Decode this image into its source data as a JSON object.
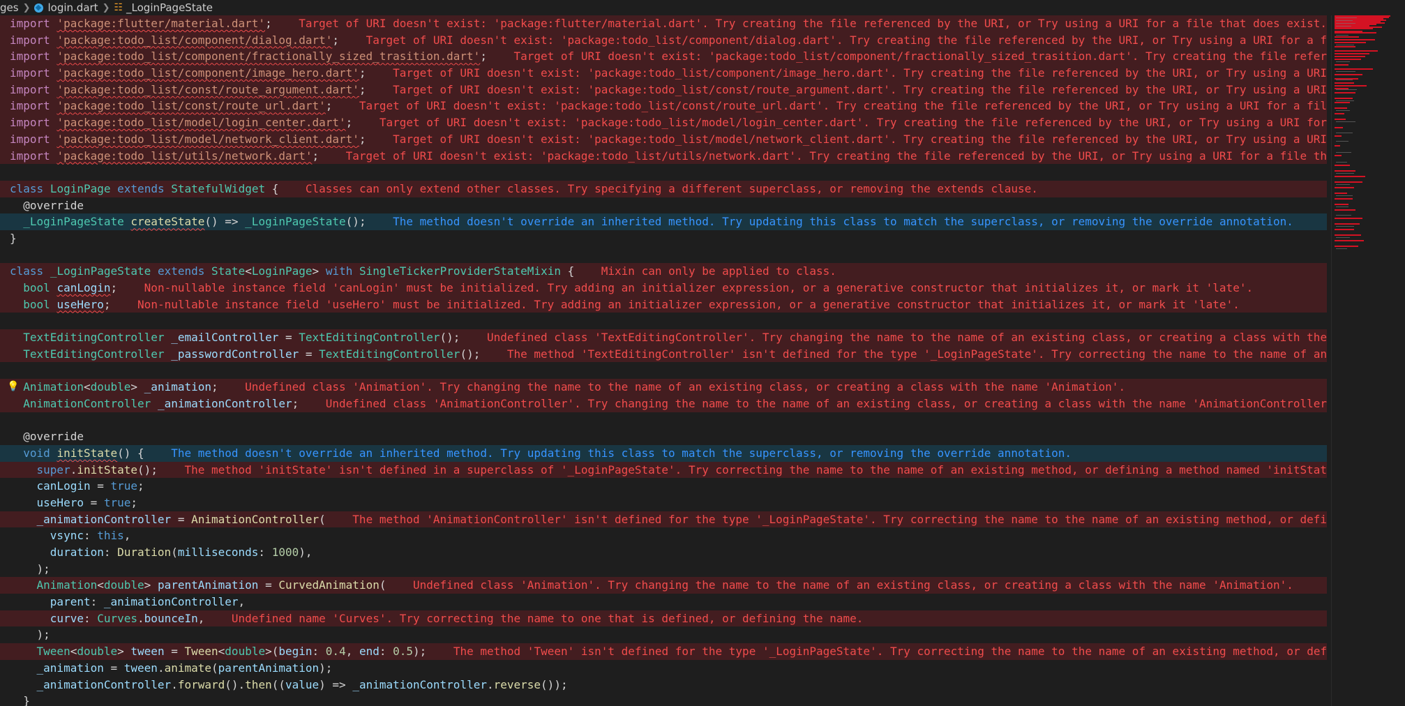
{
  "breadcrumb": {
    "folder": "ges",
    "file": "login.dart",
    "symbol": "_LoginPageState"
  },
  "lines": [
    {
      "kind": "err",
      "parts": [
        [
          "kw2",
          "import"
        ],
        [
          "",
          "&nbsp;"
        ],
        [
          "str sq",
          "'package:flutter/material.dart'"
        ],
        [
          "",
          ";"
        ]
      ],
      "msg": "Target of URI doesn't exist: 'package:flutter/material.dart'. Try creating the file referenced by the URI, or Try using a URI for a file that does exist."
    },
    {
      "kind": "err",
      "parts": [
        [
          "kw2",
          "import"
        ],
        [
          "",
          "&nbsp;"
        ],
        [
          "str sq",
          "'package:todo_list/component/dialog.dart'"
        ],
        [
          "",
          ";"
        ]
      ],
      "msg": "Target of URI doesn't exist: 'package:todo_list/component/dialog.dart'. Try creating the file referenced by the URI, or Try using a URI for a file that does exist."
    },
    {
      "kind": "err",
      "parts": [
        [
          "kw2",
          "import"
        ],
        [
          "",
          "&nbsp;"
        ],
        [
          "str sq",
          "'package:todo_list/component/fractionally_sized_trasition.dart'"
        ],
        [
          "",
          ";"
        ]
      ],
      "msg": "Target of URI doesn't exist: 'package:todo_list/component/fractionally_sized_trasition.dart'. Try creating the file referenced by the URI, or Try using a URI for a file that does exist."
    },
    {
      "kind": "err",
      "parts": [
        [
          "kw2",
          "import"
        ],
        [
          "",
          "&nbsp;"
        ],
        [
          "str sq",
          "'package:todo_list/component/image_hero.dart'"
        ],
        [
          "",
          ";"
        ]
      ],
      "msg": "Target of URI doesn't exist: 'package:todo_list/component/image_hero.dart'. Try creating the file referenced by the URI, or Try using a URI for a file that does exist."
    },
    {
      "kind": "err",
      "parts": [
        [
          "kw2",
          "import"
        ],
        [
          "",
          "&nbsp;"
        ],
        [
          "str sq",
          "'package:todo_list/const/route_argument.dart'"
        ],
        [
          "",
          ";"
        ]
      ],
      "msg": "Target of URI doesn't exist: 'package:todo_list/const/route_argument.dart'. Try creating the file referenced by the URI, or Try using a URI for a file that does exist."
    },
    {
      "kind": "err",
      "parts": [
        [
          "kw2",
          "import"
        ],
        [
          "",
          "&nbsp;"
        ],
        [
          "str sq",
          "'package:todo_list/const/route_url.dart'"
        ],
        [
          "",
          ";"
        ]
      ],
      "msg": "Target of URI doesn't exist: 'package:todo_list/const/route_url.dart'. Try creating the file referenced by the URI, or Try using a URI for a file that does exist."
    },
    {
      "kind": "err",
      "parts": [
        [
          "kw2",
          "import"
        ],
        [
          "",
          "&nbsp;"
        ],
        [
          "str sq",
          "'package:todo_list/model/login_center.dart'"
        ],
        [
          "",
          ";"
        ]
      ],
      "msg": "Target of URI doesn't exist: 'package:todo_list/model/login_center.dart'. Try creating the file referenced by the URI, or Try using a URI for a file that does exist."
    },
    {
      "kind": "err",
      "parts": [
        [
          "kw2",
          "import"
        ],
        [
          "",
          "&nbsp;"
        ],
        [
          "str sq",
          "'package:todo_list/model/network_client.dart'"
        ],
        [
          "",
          ";"
        ]
      ],
      "msg": "Target of URI doesn't exist: 'package:todo_list/model/network_client.dart'. Try creating the file referenced by the URI, or Try using a URI for a file that does exist."
    },
    {
      "kind": "err",
      "parts": [
        [
          "kw2",
          "import"
        ],
        [
          "",
          "&nbsp;"
        ],
        [
          "str sq",
          "'package:todo_list/utils/network.dart'"
        ],
        [
          "",
          ";"
        ]
      ],
      "msg": "Target of URI doesn't exist: 'package:todo_list/utils/network.dart'. Try creating the file referenced by the URI, or Try using a URI for a file that does exist."
    },
    {
      "kind": "",
      "parts": [],
      "msg": ""
    },
    {
      "kind": "err",
      "parts": [
        [
          "kw",
          "class"
        ],
        [
          "",
          "&nbsp;"
        ],
        [
          "ty",
          "LoginPage"
        ],
        [
          "",
          "&nbsp;"
        ],
        [
          "kw",
          "extends"
        ],
        [
          "",
          "&nbsp;"
        ],
        [
          "ty",
          "StatefulWidget"
        ],
        [
          "",
          "&nbsp;{"
        ]
      ],
      "msg": "Classes can only extend other classes. Try specifying a different superclass, or removing the extends clause."
    },
    {
      "kind": "",
      "parts": [
        [
          "",
          "&nbsp;&nbsp;"
        ],
        [
          "ann",
          "@override"
        ]
      ],
      "msg": ""
    },
    {
      "kind": "info",
      "parts": [
        [
          "",
          "&nbsp;&nbsp;"
        ],
        [
          "ty",
          "_LoginPageState"
        ],
        [
          "",
          "&nbsp;"
        ],
        [
          "fn sq",
          "createState"
        ],
        [
          "",
          "() => "
        ],
        [
          "ty",
          "_LoginPageState"
        ],
        [
          "",
          "();"
        ]
      ],
      "msg": "The method doesn't override an inherited method. Try updating this class to match the superclass, or removing the override annotation."
    },
    {
      "kind": "",
      "parts": [
        [
          "",
          "}"
        ]
      ],
      "msg": ""
    },
    {
      "kind": "",
      "parts": [],
      "msg": ""
    },
    {
      "kind": "err",
      "parts": [
        [
          "kw",
          "class"
        ],
        [
          "",
          "&nbsp;"
        ],
        [
          "ty",
          "_LoginPageState"
        ],
        [
          "",
          "&nbsp;"
        ],
        [
          "kw",
          "extends"
        ],
        [
          "",
          "&nbsp;"
        ],
        [
          "ty",
          "State"
        ],
        [
          "",
          "<"
        ],
        [
          "ty",
          "LoginPage"
        ],
        [
          "",
          "> "
        ],
        [
          "kw",
          "with"
        ],
        [
          "",
          "&nbsp;"
        ],
        [
          "ty",
          "SingleTickerProviderStateMixin"
        ],
        [
          "",
          "&nbsp;{"
        ]
      ],
      "msg": "Mixin can only be applied to class."
    },
    {
      "kind": "err",
      "parts": [
        [
          "",
          "&nbsp;&nbsp;"
        ],
        [
          "ty",
          "bool"
        ],
        [
          "",
          "&nbsp;"
        ],
        [
          "var sq",
          "canLogin"
        ],
        [
          "",
          ";"
        ]
      ],
      "msg": "Non-nullable instance field 'canLogin' must be initialized. Try adding an initializer expression, or a generative constructor that initializes it, or mark it 'late'."
    },
    {
      "kind": "err",
      "parts": [
        [
          "",
          "&nbsp;&nbsp;"
        ],
        [
          "ty",
          "bool"
        ],
        [
          "",
          "&nbsp;"
        ],
        [
          "var sq",
          "useHero"
        ],
        [
          "",
          ";"
        ]
      ],
      "msg": "Non-nullable instance field 'useHero' must be initialized. Try adding an initializer expression, or a generative constructor that initializes it, or mark it 'late'."
    },
    {
      "kind": "",
      "parts": [],
      "msg": ""
    },
    {
      "kind": "err",
      "parts": [
        [
          "",
          "&nbsp;&nbsp;"
        ],
        [
          "ty",
          "TextEditingController"
        ],
        [
          "",
          "&nbsp;"
        ],
        [
          "var",
          "_emailController"
        ],
        [
          "",
          " = "
        ],
        [
          "ty",
          "TextEditingController"
        ],
        [
          "",
          "();"
        ]
      ],
      "msg": "Undefined class 'TextEditingController'. Try changing the name to the name of an existing class, or creating a class with the name 'TextEditingController'."
    },
    {
      "kind": "err",
      "parts": [
        [
          "",
          "&nbsp;&nbsp;"
        ],
        [
          "ty",
          "TextEditingController"
        ],
        [
          "",
          "&nbsp;"
        ],
        [
          "var",
          "_passwordController"
        ],
        [
          "",
          ""
        ],
        [
          "",
          " = "
        ],
        [
          "ty",
          "TextEditingController"
        ],
        [
          "",
          "();"
        ]
      ],
      "msg": "The method 'TextEditingController' isn't defined for the type '_LoginPageState'. Try correcting the name to the name of an existing method."
    },
    {
      "kind": "",
      "parts": [],
      "msg": ""
    },
    {
      "kind": "err",
      "parts": [
        [
          "",
          "&nbsp;&nbsp;"
        ],
        [
          "ty",
          "Animation"
        ],
        [
          "",
          "<"
        ],
        [
          "ty",
          "double"
        ],
        [
          "",
          "> "
        ],
        [
          "var",
          "_animation"
        ],
        [
          "",
          ";"
        ]
      ],
      "msg": "Undefined class 'Animation'. Try changing the name to the name of an existing class, or creating a class with the name 'Animation'.",
      "bulb": true
    },
    {
      "kind": "err",
      "parts": [
        [
          "",
          "&nbsp;&nbsp;"
        ],
        [
          "ty",
          "AnimationController"
        ],
        [
          "",
          "&nbsp;"
        ],
        [
          "var",
          "_animationController"
        ],
        [
          "",
          ";"
        ]
      ],
      "msg": "Undefined class 'AnimationController'. Try changing the name to the name of an existing class, or creating a class with the name 'AnimationController'."
    },
    {
      "kind": "",
      "parts": [],
      "msg": ""
    },
    {
      "kind": "",
      "parts": [
        [
          "",
          "&nbsp;&nbsp;"
        ],
        [
          "ann",
          "@override"
        ]
      ],
      "msg": ""
    },
    {
      "kind": "info",
      "parts": [
        [
          "",
          "&nbsp;&nbsp;"
        ],
        [
          "kw",
          "void"
        ],
        [
          "",
          "&nbsp;"
        ],
        [
          "fn sq",
          "initState"
        ],
        [
          "",
          "() {"
        ]
      ],
      "msg": "The method doesn't override an inherited method. Try updating this class to match the superclass, or removing the override annotation."
    },
    {
      "kind": "err",
      "parts": [
        [
          "",
          "&nbsp;&nbsp;&nbsp;&nbsp;"
        ],
        [
          "kw",
          "super"
        ],
        [
          "",
          "."
        ],
        [
          "fn",
          "initState"
        ],
        [
          "",
          "();"
        ]
      ],
      "msg": "The method 'initState' isn't defined in a superclass of '_LoginPageState'. Try correcting the name to the name of an existing method, or defining a method named 'initState'."
    },
    {
      "kind": "",
      "parts": [
        [
          "",
          "&nbsp;&nbsp;&nbsp;&nbsp;"
        ],
        [
          "var",
          "canLogin"
        ],
        [
          "",
          " = "
        ],
        [
          "kw",
          "true"
        ],
        [
          "",
          ";"
        ]
      ],
      "msg": ""
    },
    {
      "kind": "",
      "parts": [
        [
          "",
          "&nbsp;&nbsp;&nbsp;&nbsp;"
        ],
        [
          "var",
          "useHero"
        ],
        [
          "",
          " = "
        ],
        [
          "kw",
          "true"
        ],
        [
          "",
          ";"
        ]
      ],
      "msg": ""
    },
    {
      "kind": "err",
      "parts": [
        [
          "",
          "&nbsp;&nbsp;&nbsp;&nbsp;"
        ],
        [
          "var",
          "_animationController"
        ],
        [
          "",
          " = "
        ],
        [
          "fn",
          "AnimationController"
        ],
        [
          "",
          "("
        ]
      ],
      "msg": "The method 'AnimationController' isn't defined for the type '_LoginPageState'. Try correcting the name to the name of an existing method, or defining a method."
    },
    {
      "kind": "",
      "parts": [
        [
          "",
          "&nbsp;&nbsp;&nbsp;&nbsp;&nbsp;&nbsp;"
        ],
        [
          "var",
          "vsync"
        ],
        [
          "",
          ": "
        ],
        [
          "kw",
          "this"
        ],
        [
          "",
          ","
        ]
      ],
      "msg": ""
    },
    {
      "kind": "",
      "parts": [
        [
          "",
          "&nbsp;&nbsp;&nbsp;&nbsp;&nbsp;&nbsp;"
        ],
        [
          "var",
          "duration"
        ],
        [
          "",
          ": "
        ],
        [
          "fn",
          "Duration"
        ],
        [
          "",
          "("
        ],
        [
          "var",
          "milliseconds"
        ],
        [
          "",
          ": "
        ],
        [
          "num",
          "1000"
        ],
        [
          "",
          "),"
        ]
      ],
      "msg": ""
    },
    {
      "kind": "",
      "parts": [
        [
          "",
          "&nbsp;&nbsp;&nbsp;&nbsp;);"
        ]
      ],
      "msg": ""
    },
    {
      "kind": "err",
      "parts": [
        [
          "",
          "&nbsp;&nbsp;&nbsp;&nbsp;"
        ],
        [
          "ty",
          "Animation"
        ],
        [
          "",
          "<"
        ],
        [
          "ty",
          "double"
        ],
        [
          "",
          "> "
        ],
        [
          "var",
          "parentAnimation"
        ],
        [
          "",
          " = "
        ],
        [
          "fn",
          "CurvedAnimation"
        ],
        [
          "",
          "("
        ]
      ],
      "msg": "Undefined class 'Animation'. Try changing the name to the name of an existing class, or creating a class with the name 'Animation'."
    },
    {
      "kind": "",
      "parts": [
        [
          "",
          "&nbsp;&nbsp;&nbsp;&nbsp;&nbsp;&nbsp;"
        ],
        [
          "var",
          "parent"
        ],
        [
          "",
          ": "
        ],
        [
          "var",
          "_animationController"
        ],
        [
          "",
          ","
        ]
      ],
      "msg": ""
    },
    {
      "kind": "err",
      "parts": [
        [
          "",
          "&nbsp;&nbsp;&nbsp;&nbsp;&nbsp;&nbsp;"
        ],
        [
          "var",
          "curve"
        ],
        [
          "",
          ": "
        ],
        [
          "ty",
          "Curves"
        ],
        [
          "",
          "."
        ],
        [
          "var",
          "bounceIn"
        ],
        [
          "",
          ","
        ]
      ],
      "msg": "Undefined name 'Curves'. Try correcting the name to one that is defined, or defining the name."
    },
    {
      "kind": "",
      "parts": [
        [
          "",
          "&nbsp;&nbsp;&nbsp;&nbsp;);"
        ]
      ],
      "msg": ""
    },
    {
      "kind": "err",
      "parts": [
        [
          "",
          "&nbsp;&nbsp;&nbsp;&nbsp;"
        ],
        [
          "ty",
          "Tween"
        ],
        [
          "",
          "<"
        ],
        [
          "ty",
          "double"
        ],
        [
          "",
          "> "
        ],
        [
          "var",
          "tween"
        ],
        [
          "",
          " = "
        ],
        [
          "fn",
          "Tween"
        ],
        [
          "",
          "<"
        ],
        [
          "ty",
          "double"
        ],
        [
          "",
          ">("
        ],
        [
          "var",
          "begin"
        ],
        [
          "",
          ": "
        ],
        [
          "num",
          "0.4"
        ],
        [
          "",
          ", "
        ],
        [
          "var",
          "end"
        ],
        [
          "",
          ": "
        ],
        [
          "num",
          "0.5"
        ],
        [
          "",
          ");"
        ]
      ],
      "msg": "The method 'Tween' isn't defined for the type '_LoginPageState'. Try correcting the name to the name of an existing method, or defining a method named 'Tween'."
    },
    {
      "kind": "",
      "parts": [
        [
          "",
          "&nbsp;&nbsp;&nbsp;&nbsp;"
        ],
        [
          "var",
          "_animation"
        ],
        [
          "",
          " = "
        ],
        [
          "var",
          "tween"
        ],
        [
          "",
          "."
        ],
        [
          "fn",
          "animate"
        ],
        [
          "",
          "("
        ],
        [
          "var",
          "parentAnimation"
        ],
        [
          "",
          ");"
        ]
      ],
      "msg": ""
    },
    {
      "kind": "",
      "parts": [
        [
          "",
          "&nbsp;&nbsp;&nbsp;&nbsp;"
        ],
        [
          "var",
          "_animationController"
        ],
        [
          "",
          "."
        ],
        [
          "fn",
          "forward"
        ],
        [
          "",
          "()."
        ],
        [
          "fn",
          "then"
        ],
        [
          "",
          "(("
        ],
        [
          "var",
          "value"
        ],
        [
          "",
          ") => "
        ],
        [
          "var",
          "_animationController"
        ],
        [
          "",
          "."
        ],
        [
          "fn",
          "reverse"
        ],
        [
          "",
          "());"
        ]
      ],
      "msg": ""
    },
    {
      "kind": "",
      "parts": [
        [
          "",
          "&nbsp;&nbsp;}"
        ]
      ],
      "msg": ""
    }
  ]
}
